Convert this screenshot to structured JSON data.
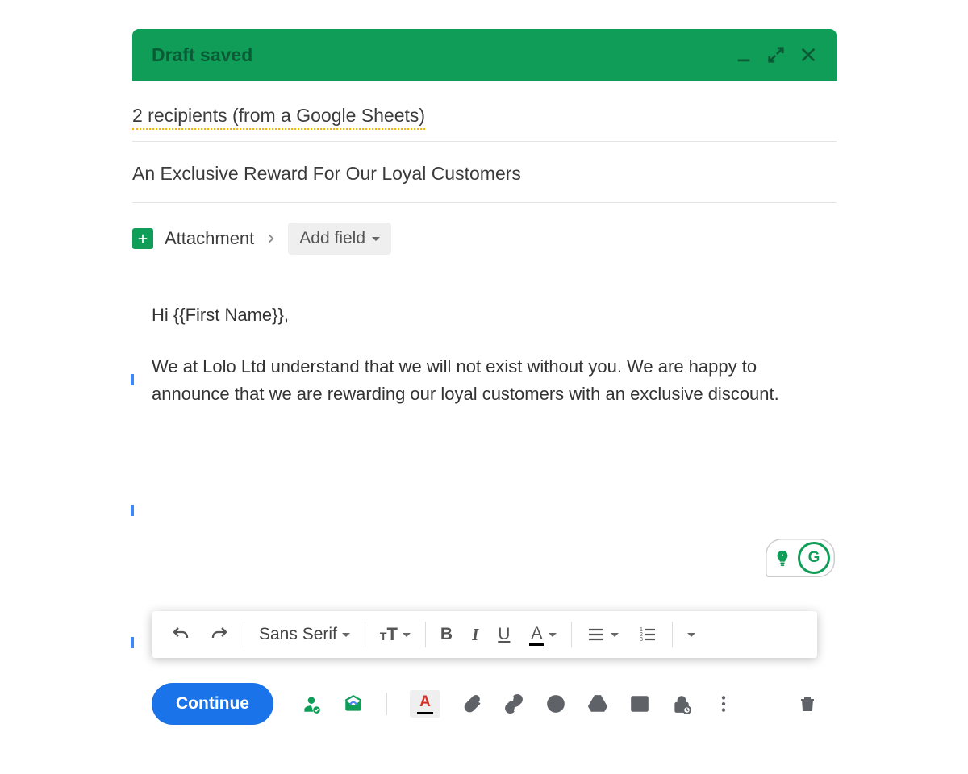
{
  "header": {
    "title": "Draft saved"
  },
  "recipients": {
    "summary": "2 recipients (from a Google Sheets)"
  },
  "subject": {
    "text": "An Exclusive Reward For Our Loyal Customers"
  },
  "attachbar": {
    "label": "Attachment",
    "addfield_label": "Add field"
  },
  "body": {
    "greeting": "Hi {{First Name}},",
    "para1": "We at Lolo Ltd understand that we will not exist without you. We are happy to announce that we are rewarding our loyal customers with an exclusive discount."
  },
  "format_toolbar": {
    "font": "Sans Serif"
  },
  "footer": {
    "send_label": "Continue"
  },
  "assist": {
    "g_label": "G"
  },
  "colors": {
    "accent": "#0f9d58",
    "primary": "#1a73e8"
  }
}
